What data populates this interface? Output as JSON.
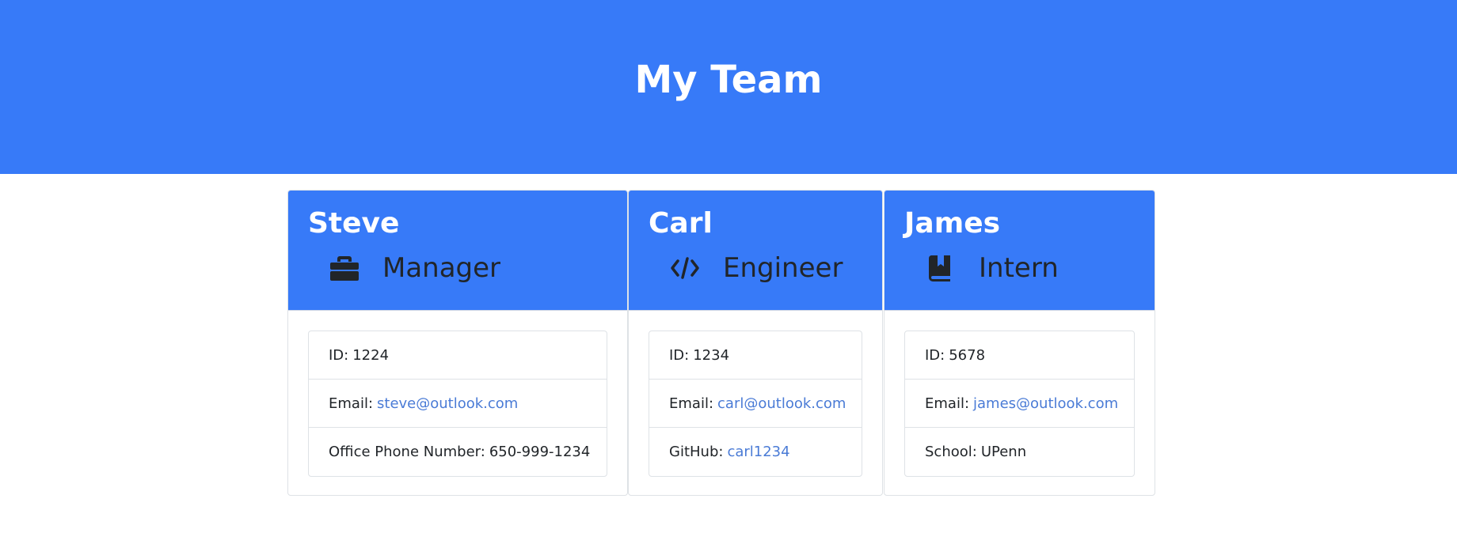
{
  "header": {
    "title": "My Team"
  },
  "colors": {
    "accent": "#377af8",
    "link": "#4a7bd6",
    "text": "#212529"
  },
  "cards": [
    {
      "name": "Steve",
      "role": "Manager",
      "role_icon": "briefcase-icon",
      "id_label": "ID:",
      "id": "1224",
      "email_label": "Email:",
      "email": "steve@outlook.com",
      "extra_label": "Office Phone Number:",
      "extra": "650-999-1234"
    },
    {
      "name": "Carl",
      "role": "Engineer",
      "role_icon": "code-icon",
      "id_label": "ID:",
      "id": "1234",
      "email_label": "Email:",
      "email": "carl@outlook.com",
      "extra_label": "GitHub:",
      "extra": "carl1234"
    },
    {
      "name": "James",
      "role": "Intern",
      "role_icon": "book-icon",
      "id_label": "ID:",
      "id": "5678",
      "email_label": "Email:",
      "email": "james@outlook.com",
      "extra_label": "School:",
      "extra": "UPenn"
    }
  ]
}
